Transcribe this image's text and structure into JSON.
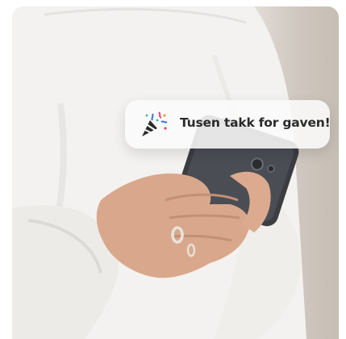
{
  "photo": {
    "subject": "person-using-smartphone",
    "colors": {
      "sweater": "#f1f0ee",
      "skin": "#d9a88c",
      "phone": "#3b3d42"
    }
  },
  "notification": {
    "icon": "party-popper-icon",
    "text": "Tusen takk for gaven!"
  }
}
